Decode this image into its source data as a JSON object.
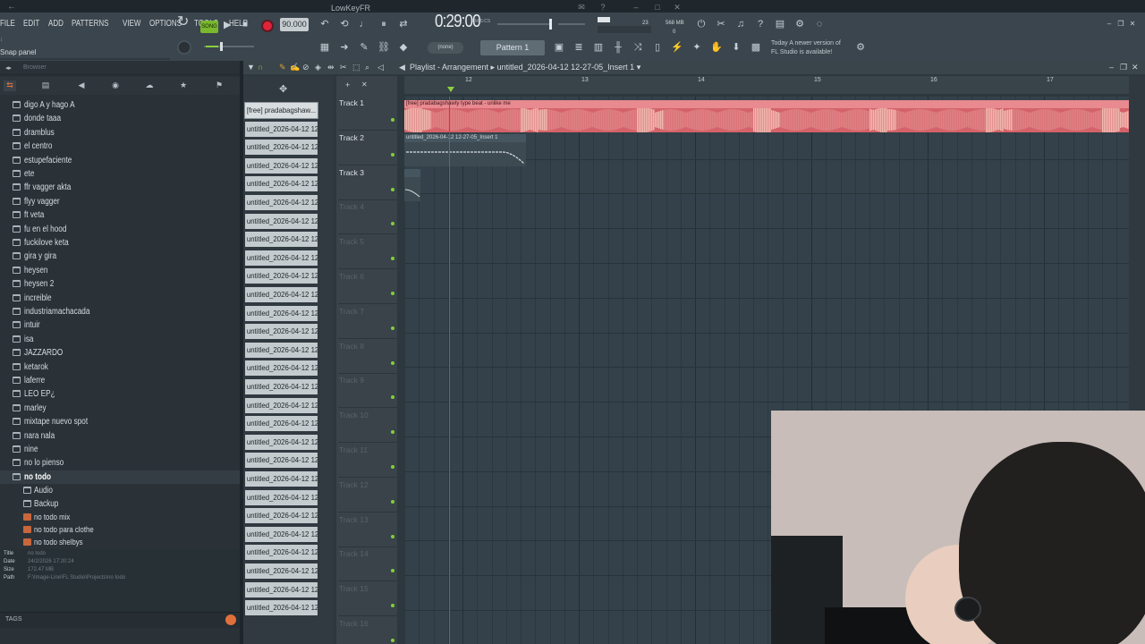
{
  "window": {
    "title": "LowKeyFR"
  },
  "menu": [
    "FILE",
    "EDIT",
    "ADD",
    "PATTERNS",
    "VIEW",
    "OPTIONS",
    "TOOLS",
    "HELP"
  ],
  "transport": {
    "mode": "SONG",
    "tempo": "90.000",
    "time": "0:29:00",
    "time_unit": "M:S:CS"
  },
  "monitor": {
    "cpu": "23",
    "ram": "568 MB",
    "poly": "0"
  },
  "toolbar2": {
    "snap_panel": "Snap panel",
    "snap_value": "(none)",
    "pattern": "Pattern 1"
  },
  "news": {
    "line1": "Today  A newer version of",
    "line2": "FL Studio is available!"
  },
  "browser": {
    "title": "Browser",
    "folders": [
      "digo A y hago A",
      "donde taaa",
      "dramblus",
      "el centro",
      "estupefaciente",
      "ete",
      "ffr vagger akta",
      "flyy vagger",
      "ft veta",
      "fu en el hood",
      "fuckilove keta",
      "gira y gira",
      "heysen",
      "heysen 2",
      "increible",
      "industriamachacada",
      "intuir",
      "isa",
      "JAZZARDO",
      "ketarok",
      "laferre",
      "LEO EP¿",
      "marley",
      "mixtape nuevo spot",
      "nara nala",
      "nine",
      "no lo pienso",
      "no todo"
    ],
    "subfolders": [
      "Audio",
      "Backup"
    ],
    "files": [
      "no todo mix",
      "no todo para clothe",
      "no todo shelbys"
    ],
    "info": {
      "title_label": "Title",
      "title": "no todo",
      "date_label": "Date",
      "date": "24/2/2026 17:20:24",
      "size_label": "Size",
      "size": "172.47 MB",
      "path_label": "Path",
      "path": "F:\\Image-Line\\FL Studio\\Projects\\no todo"
    },
    "tags": "TAGS"
  },
  "playlist": {
    "title": "Playlist - Arrangement",
    "arrangement": "untitled_2026-04-12 12-27-05_Insert 1",
    "patterns": [
      "[free] pradabagshaw...",
      "untitled_2026-04-12 12-...",
      "untitled_2026-04-12 12-...",
      "untitled_2026-04-12 12-...",
      "untitled_2026-04-12 12-...",
      "untitled_2026-04-12 12-...",
      "untitled_2026-04-12 12-...",
      "untitled_2026-04-12 12-...",
      "untitled_2026-04-12 12-...",
      "untitled_2026-04-12 12-...",
      "untitled_2026-04-12 12-...",
      "untitled_2026-04-12 12-...",
      "untitled_2026-04-12 12-...",
      "untitled_2026-04-12 12-...",
      "untitled_2026-04-12 12-...",
      "untitled_2026-04-12 12-...",
      "untitled_2026-04-12 12-...",
      "untitled_2026-04-12 12-...",
      "untitled_2026-04-12 12-...",
      "untitled_2026-04-12 12-...",
      "untitled_2026-04-12 12-...",
      "untitled_2026-04-12 12-...",
      "untitled_2026-04-12 12-...",
      "untitled_2026-04-12 12-...",
      "untitled_2026-04-12 12-...",
      "untitled_2026-04-12 12-...",
      "untitled_2026-04-12 12-...",
      "untitled_2026-04-12 12-..."
    ],
    "tracks": [
      "Track 1",
      "Track 2",
      "Track 3",
      "Track 4",
      "Track 5",
      "Track 6",
      "Track 7",
      "Track 8",
      "Track 9",
      "Track 10",
      "Track 11",
      "Track 12",
      "Track 13",
      "Track 14",
      "Track 15",
      "Track 16"
    ],
    "bars": [
      "12",
      "13",
      "14",
      "15",
      "16",
      "17"
    ],
    "clips": [
      {
        "track": 1,
        "label": "[free] pradabagshawty type beat - unlike me"
      },
      {
        "track": 2,
        "label": "untitled_2026-04-12 12-27-05_Insert 1"
      },
      {
        "track": 3,
        "label": ""
      }
    ]
  },
  "colors": {
    "accent": "#8ad13d",
    "record": "#e0243a",
    "audio_clip": "#d4626a",
    "pattern_bg": "#c4cbcf"
  }
}
